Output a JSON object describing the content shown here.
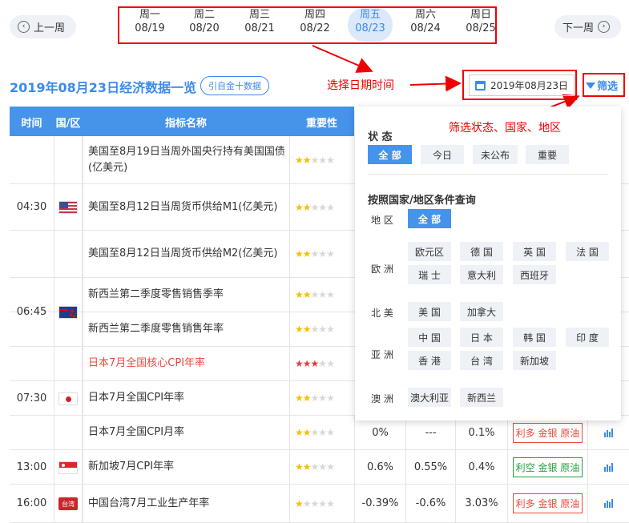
{
  "week_nav": {
    "prev_label": "上一周",
    "next_label": "下一周",
    "days": [
      {
        "weekday": "周一",
        "date": "08/19"
      },
      {
        "weekday": "周二",
        "date": "08/20"
      },
      {
        "weekday": "周三",
        "date": "08/21"
      },
      {
        "weekday": "周四",
        "date": "08/22"
      },
      {
        "weekday": "周五",
        "date": "08/23",
        "active": true
      },
      {
        "weekday": "周六",
        "date": "08/24"
      },
      {
        "weekday": "周日",
        "date": "08/25"
      }
    ]
  },
  "header": {
    "title": "2019年08月23日经济数据一览",
    "pill_label": "引自金十数据",
    "date_value": "2019年08月23日",
    "filter_label": "筛选"
  },
  "annotations": {
    "date_note": "选择日期时间",
    "filter_note": "筛选状态、国家、地区"
  },
  "table": {
    "columns": [
      "时间",
      "国/区",
      "指标名称",
      "重要性"
    ],
    "rows": [
      {
        "indicator": "美国至8月19日当周外国央行持有美国国债(亿美元)",
        "stars": 2
      },
      {
        "indicator": "美国至8月12日当周货币供给M1(亿美元)",
        "stars": 2
      },
      {
        "indicator": "美国至8月12日当周货币供给M2(亿美元)",
        "stars": 2
      },
      {
        "indicator": "新西兰第二季度零售销售季率",
        "stars": 2
      },
      {
        "indicator": "新西兰第二季度零售销售年率",
        "stars": 2
      },
      {
        "indicator": "日本7月全国核心CPI年率",
        "stars": 3,
        "highlight": true
      },
      {
        "indicator": "日本7月全国CPI年率",
        "stars": 2
      },
      {
        "indicator": "日本7月全国CPI月率",
        "stars": 2,
        "prev": "0%",
        "forecast": "---",
        "actual": "0.1%",
        "effect": "利多 金银 原油",
        "effect_type": "bullish"
      },
      {
        "indicator": "新加坡7月CPI年率",
        "stars": 2,
        "prev": "0.6%",
        "forecast": "0.55%",
        "actual": "0.4%",
        "effect": "利空 金银 原油",
        "effect_type": "bearish"
      },
      {
        "indicator": "中国台湾7月工业生产年率",
        "stars": 1,
        "prev": "-0.39%",
        "forecast": "-0.6%",
        "actual": "3.03%",
        "effect": "利多 金银 原油",
        "effect_type": "bullish"
      }
    ],
    "time_groups": [
      "04:30",
      "06:45",
      "07:30",
      "13:00",
      "16:00"
    ],
    "tw_flag_text": "台湾"
  },
  "filter_panel": {
    "status_heading": "状 态",
    "status_options": [
      "全 部",
      "今日",
      "未公布",
      "重要"
    ],
    "region_heading": "按照国家/地区条件查询",
    "area_label": "地 区",
    "area_all": "全 部",
    "groups": {
      "europe": {
        "label": "欧 洲",
        "items": [
          "欧元区",
          "德 国",
          "英 国",
          "法 国",
          "瑞 士",
          "意大利",
          "西班牙"
        ]
      },
      "north_america": {
        "label": "北 美",
        "items": [
          "美 国",
          "加拿大"
        ]
      },
      "asia": {
        "label": "亚 洲",
        "items": [
          "中 国",
          "日 本",
          "韩 国",
          "印 度",
          "香 港",
          "台 湾",
          "新加坡"
        ]
      },
      "oceania": {
        "label": "澳 洲",
        "items": [
          "澳大利亚",
          "新西兰"
        ]
      }
    }
  }
}
